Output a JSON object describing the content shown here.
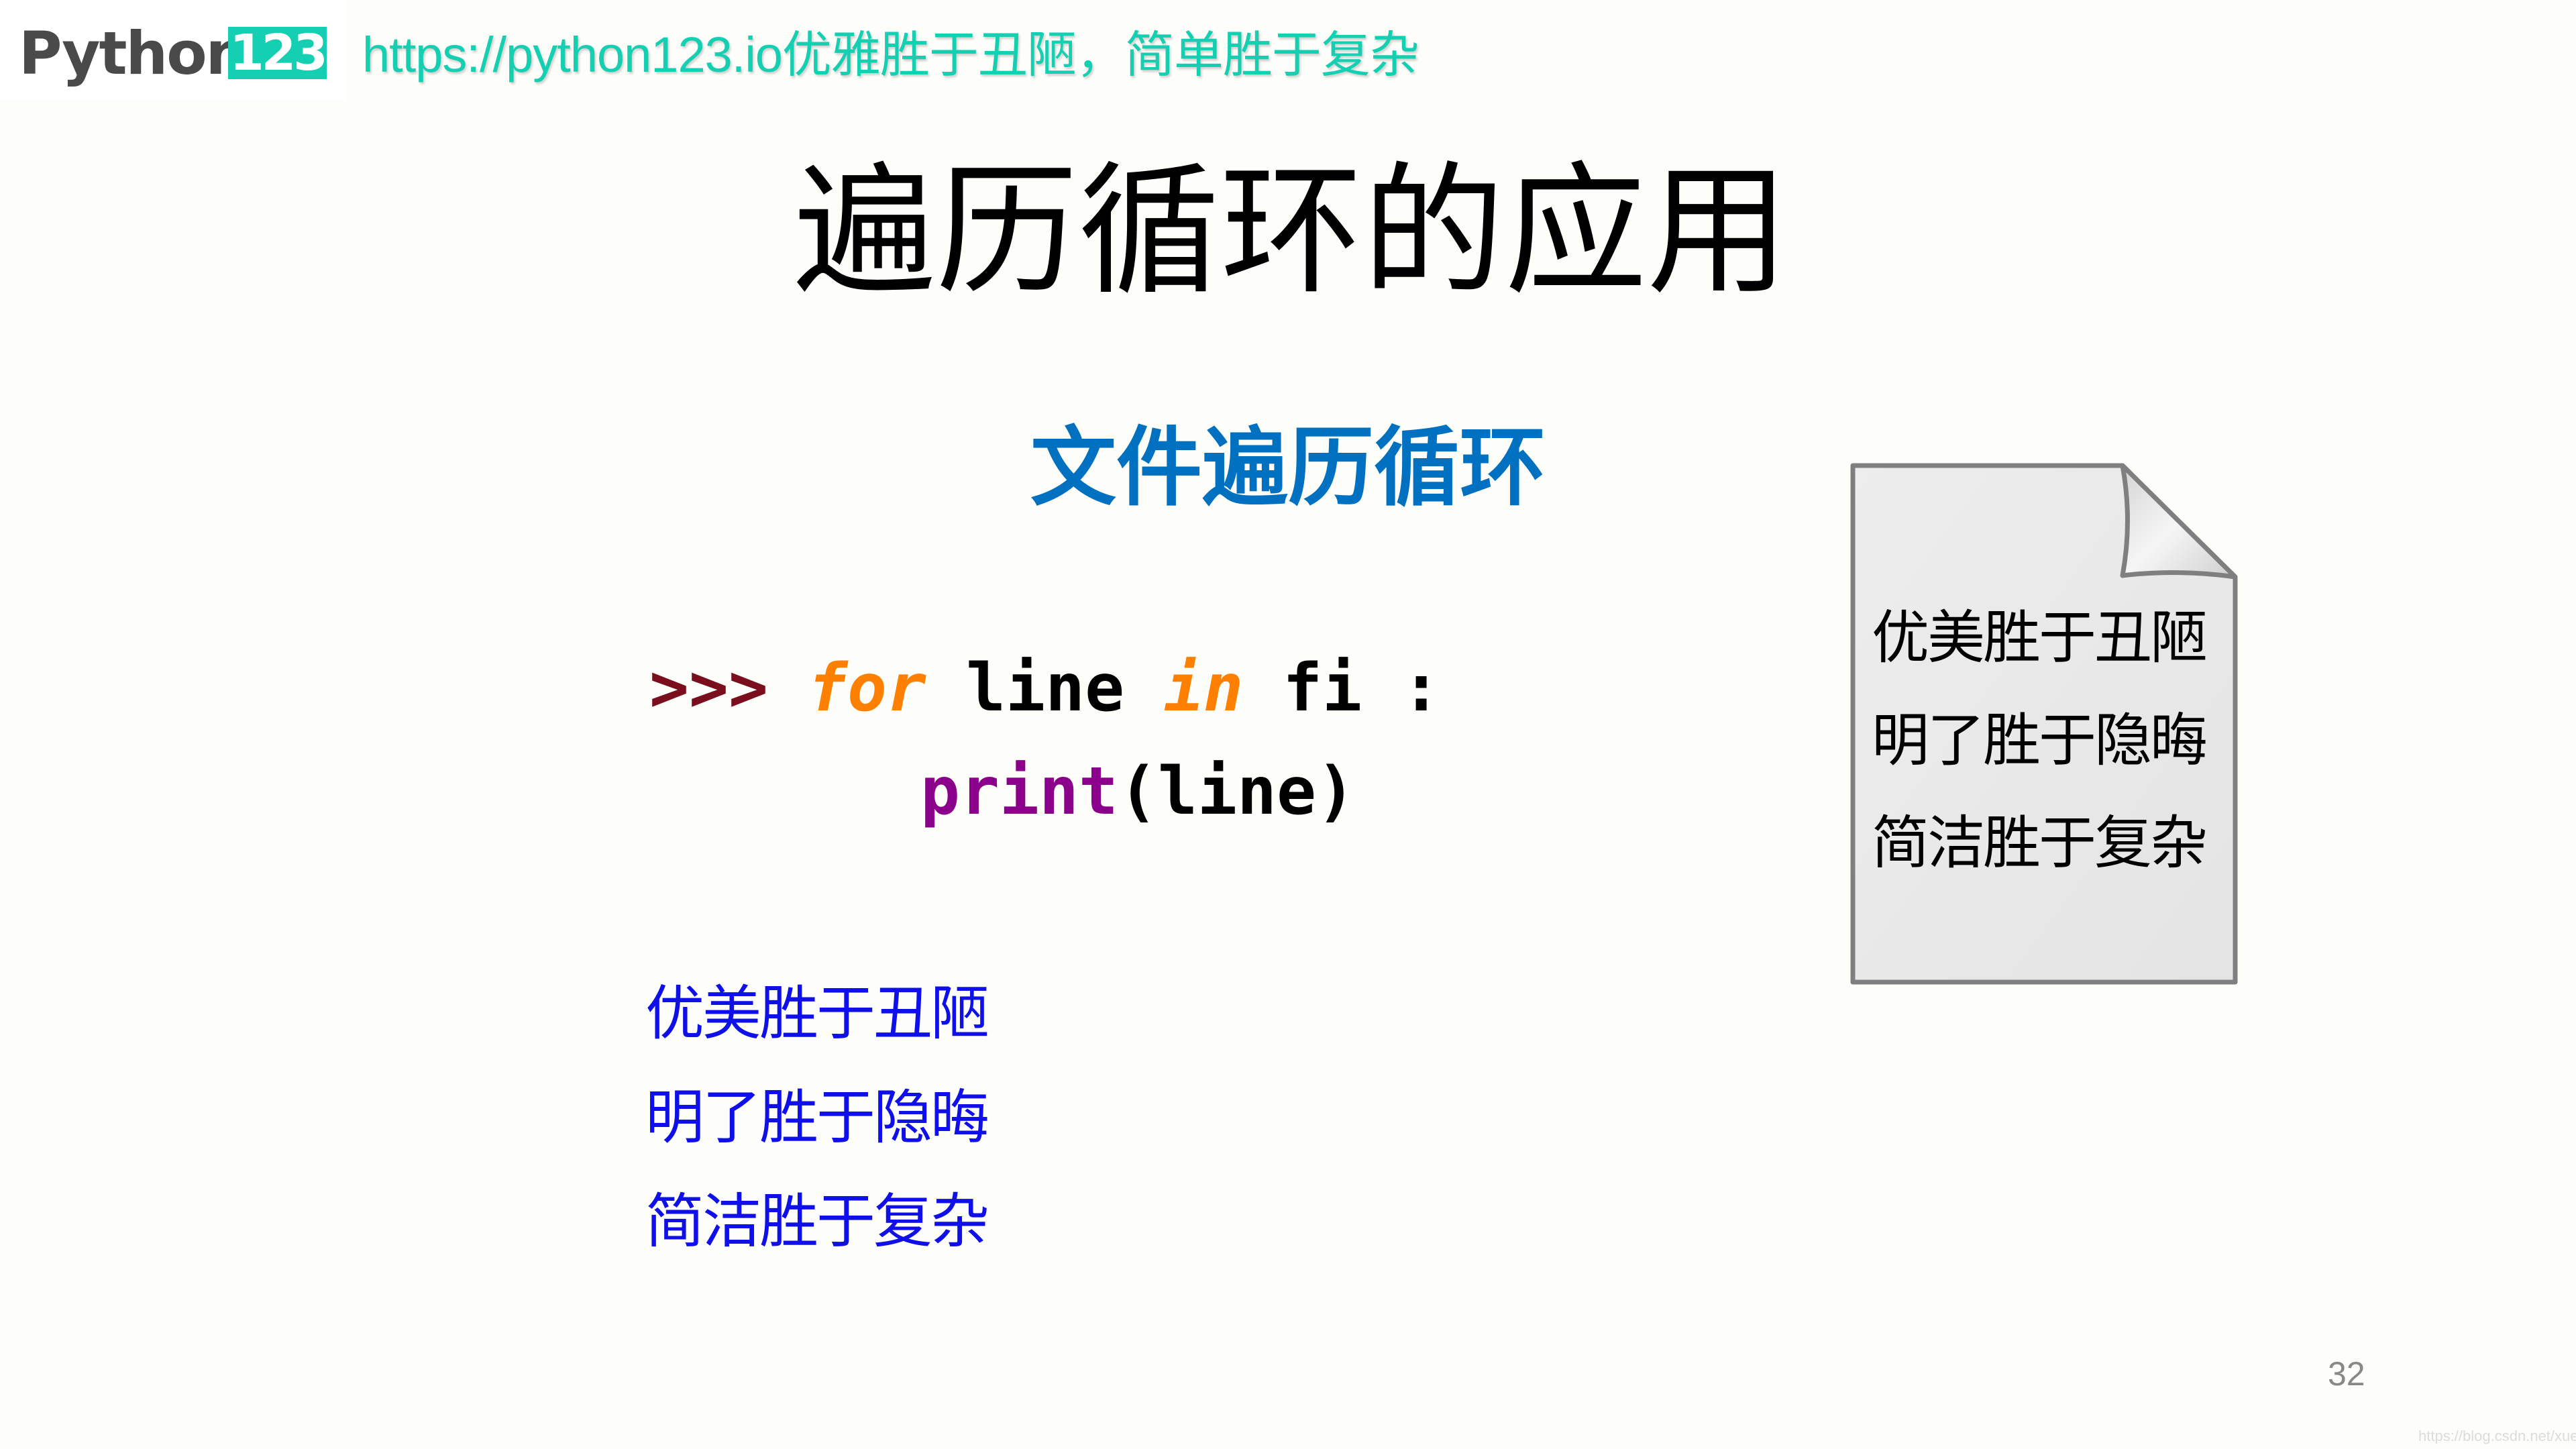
{
  "header": {
    "logo_text": "Python",
    "logo_badge": "123",
    "tagline": "https://python123.io优雅胜于丑陋，简单胜于复杂"
  },
  "slide": {
    "title": "遍历循环的应用",
    "subtitle": "文件遍历循环",
    "code": {
      "line1": {
        "prompt": ">>>",
        "kw_for": "for",
        "var": "line",
        "kw_in": "in",
        "iterable": "fi",
        "colon": ":"
      },
      "line2": {
        "builtin": "print",
        "args": "(line)"
      }
    },
    "output_lines": [
      "优美胜于丑陋",
      "明了胜于隐晦",
      "简洁胜于复杂"
    ],
    "document_icon": {
      "icon": "file-document-icon",
      "lines": [
        "优美胜于丑陋",
        "明了胜于隐晦",
        "简洁胜于复杂"
      ]
    },
    "page_number": "32"
  },
  "watermark": "https://blog.csdn.net/xuehangpy",
  "colors": {
    "brand_teal": "#14CFB2",
    "subtitle_blue": "#0070C0",
    "output_blue": "#0F0FEA",
    "prompt_red": "#7A0E1C",
    "keyword_orange": "#FF7F00",
    "builtin_purple": "#8B008B"
  }
}
